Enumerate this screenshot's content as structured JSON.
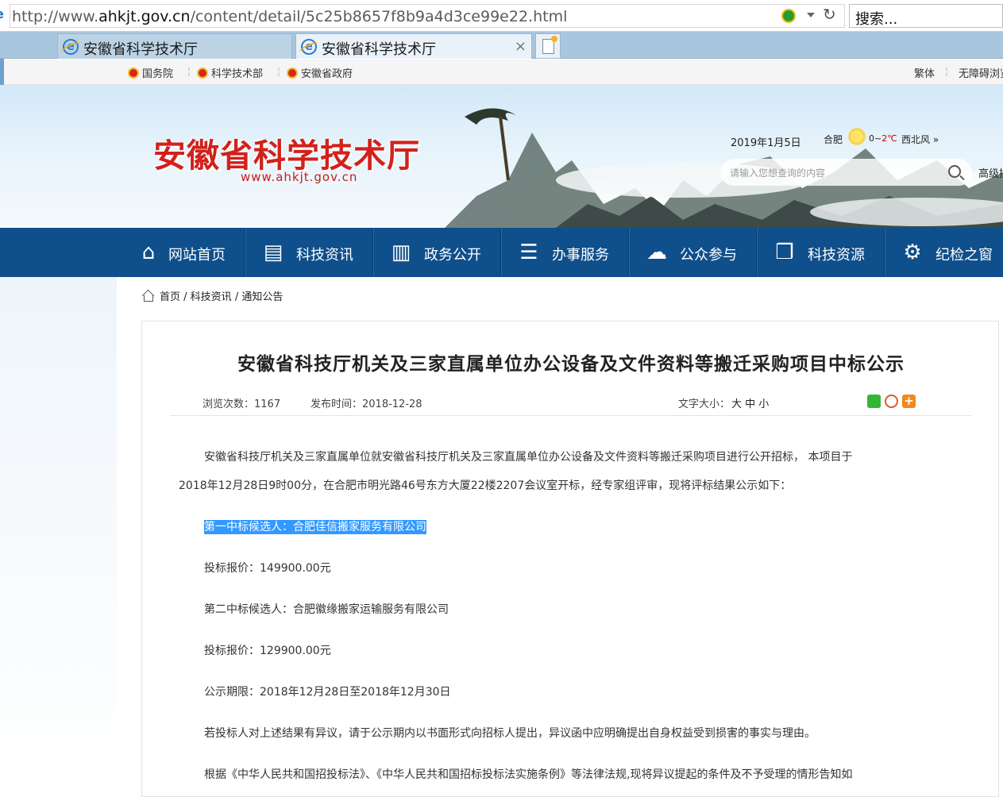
{
  "browser": {
    "url_prefix": "http://www.",
    "url_domain": "ahkjt.gov.cn",
    "url_path": "/content/detail/5c25b8657f8b9a4d3ce99e22.html",
    "search_placeholder": "搜索...",
    "tabs": [
      {
        "label": "安徽省科学技术厅"
      },
      {
        "label": "安徽省科学技术厅",
        "close": "×"
      }
    ]
  },
  "toplinks": {
    "items": [
      "国务院",
      "科学技术部",
      "安徽省政府"
    ],
    "traditional": "繁体",
    "accessibility": "无障碍浏览"
  },
  "banner": {
    "title": "安徽省科学技术厅",
    "url": "www.ahkjt.gov.cn",
    "date": "2019年1月5日",
    "city": "合肥",
    "temp_low": "0",
    "temp_sep": "~",
    "temp_high": "2℃",
    "wind": "西北风 »",
    "search_placeholder": "请输入您想查询的内容",
    "advanced": "高级搜索"
  },
  "nav": {
    "items": [
      {
        "label": "网站首页",
        "icon": "home-icon"
      },
      {
        "label": "科技资讯",
        "icon": "document-icon"
      },
      {
        "label": "政务公开",
        "icon": "book-icon"
      },
      {
        "label": "办事服务",
        "icon": "service-icon"
      },
      {
        "label": "公众参与",
        "icon": "chat-icon"
      },
      {
        "label": "科技资源",
        "icon": "cube-icon"
      },
      {
        "label": "纪检之窗",
        "icon": "gear-icon"
      }
    ]
  },
  "breadcrumb": {
    "home": "首页",
    "sep1": " / ",
    "section": "科技资讯",
    "sep2": " / ",
    "page": "通知公告"
  },
  "article": {
    "title": "安徽省科技厅机关及三家直属单位办公设备及文件资料等搬迁采购项目中标公示",
    "views_label": "浏览次数：",
    "views": "1167",
    "date_label": "发布时间：",
    "date": "2018-12-28",
    "fontsize_label": "文字大小：",
    "fontsize_options": "大 中 小",
    "share_more": "+",
    "p1": "安徽省科技厅机关及三家直属单位就安徽省科技厅机关及三家直属单位办公设备及文件资料等搬迁采购项目进行公开招标， 本项目于",
    "p1b": "2018年12月28日9时00分，在合肥市明光路46号东方大厦22楼2207会议室开标，经专家组评审，现将评标结果公示如下：",
    "first_candidate": "第一中标候选人：合肥佳信搬家服务有限公司",
    "first_price": "投标报价：149900.00元",
    "second_candidate": "第二中标候选人：合肥徽缘搬家运输服务有限公司",
    "second_price": "投标报价：129900.00元",
    "period": "公示期限：2018年12月28日至2018年12月30日",
    "objection": "若投标人对上述结果有异议，请于公示期内以书面形式向招标人提出，异议函中应明确提出自身权益受到损害的事实与理由。",
    "law": "根据《中华人民共和国招投标法》、《中华人民共和国招标投标法实施条例》等法律法规,现将异议提起的条件及不予受理的情形告知如"
  }
}
